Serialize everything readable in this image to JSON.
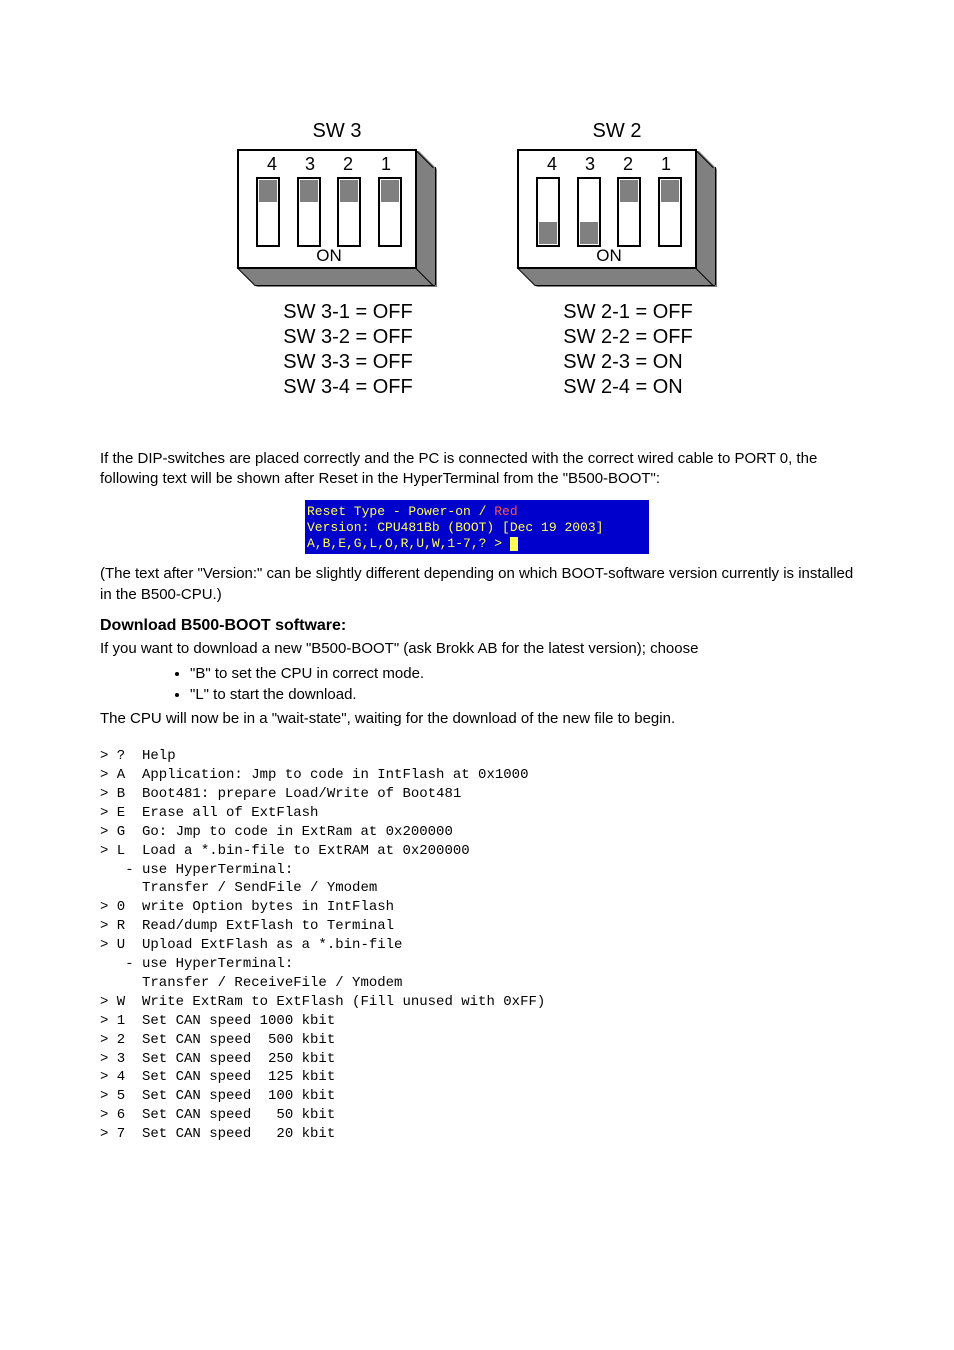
{
  "dip_banks": [
    {
      "title": "SW 3",
      "numbers": [
        "4",
        "3",
        "2",
        "1"
      ],
      "on_label": "ON",
      "slots": [
        "off",
        "off",
        "off",
        "off"
      ],
      "states": [
        "SW 3-1 = OFF",
        "SW 3-2 = OFF",
        "SW 3-3 = OFF",
        "SW 3-4 = OFF"
      ]
    },
    {
      "title": "SW 2",
      "numbers": [
        "4",
        "3",
        "2",
        "1"
      ],
      "on_label": "ON",
      "slots": [
        "on",
        "on",
        "off",
        "off"
      ],
      "states": [
        "SW 2-1 = OFF",
        "SW 2-2 = OFF",
        "SW 2-3 = ON",
        "SW 2-4 = ON"
      ]
    }
  ],
  "intro": "If the DIP-switches are placed correctly and the PC is connected with the correct wired cable to PORT 0, the following text will be shown after Reset in the HyperTerminal from the \"B500-BOOT\":",
  "terminal": {
    "line1_prefix": "Reset Type - Power-on / ",
    "line1_red": "Red",
    "line2": "Version: CPU481Bb (BOOT) [Dec 19 2003]",
    "line3": "A,B,E,G,L,O,R,U,W,1-7,? > "
  },
  "post_term": "(The text after \"Version:\" can be slightly different depending on which BOOT-software version currently is installed in the B500-CPU.)",
  "section_title": "Download B500-BOOT software:",
  "section_para": "If you want to download a new \"B500-BOOT\" (ask Brokk AB for the latest version); choose",
  "bullets": [
    "\"B\" to set the CPU in correct mode.",
    "\"L\" to start the download."
  ],
  "after_bullets": "The CPU will now be in a \"wait-state\", waiting for the download of the new file to begin.",
  "help": "> ?  Help\n> A  Application: Jmp to code in IntFlash at 0x1000\n> B  Boot481: prepare Load/Write of Boot481\n> E  Erase all of ExtFlash\n> G  Go: Jmp to code in ExtRam at 0x200000\n> L  Load a *.bin-file to ExtRAM at 0x200000\n   - use HyperTerminal:\n     Transfer / SendFile / Ymodem\n> 0  write Option bytes in IntFlash\n> R  Read/dump ExtFlash to Terminal\n> U  Upload ExtFlash as a *.bin-file\n   - use HyperTerminal:\n     Transfer / ReceiveFile / Ymodem\n> W  Write ExtRam to ExtFlash (Fill unused with 0xFF)\n> 1  Set CAN speed 1000 kbit\n> 2  Set CAN speed  500 kbit\n> 3  Set CAN speed  250 kbit\n> 4  Set CAN speed  125 kbit\n> 5  Set CAN speed  100 kbit\n> 6  Set CAN speed   50 kbit\n> 7  Set CAN speed   20 kbit"
}
